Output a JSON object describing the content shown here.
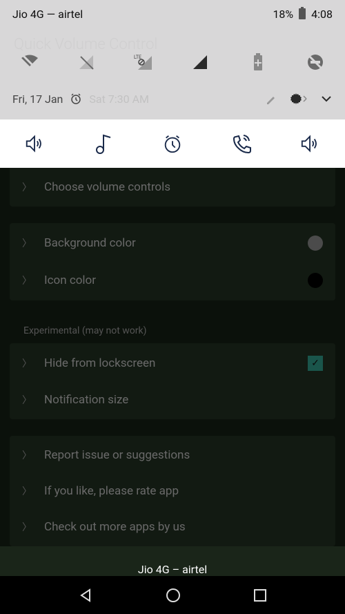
{
  "status_bar": {
    "carrier": "Jio 4G — airtel",
    "battery_pct": "18%",
    "time": "4:08"
  },
  "qs": {
    "title_ghost": "Quick Volume Control",
    "date": "Fri, 17 Jan",
    "alarm_ghost": "Sat 7:30 AM"
  },
  "settings": {
    "choose_volume": "Choose volume controls",
    "bg_color": "Background color",
    "icon_color": "Icon color",
    "experimental_label": "Experimental (may not work)",
    "hide_lock": "Hide from lockscreen",
    "notif_size": "Notification size",
    "report": "Report issue or suggestions",
    "rate": "If you like, please rate app",
    "more_apps": "Check out more apps by us"
  },
  "toast": "Jio 4G – airtel",
  "colors": {
    "bg_dot": "#7a7a7a",
    "icon_dot": "#000000"
  }
}
